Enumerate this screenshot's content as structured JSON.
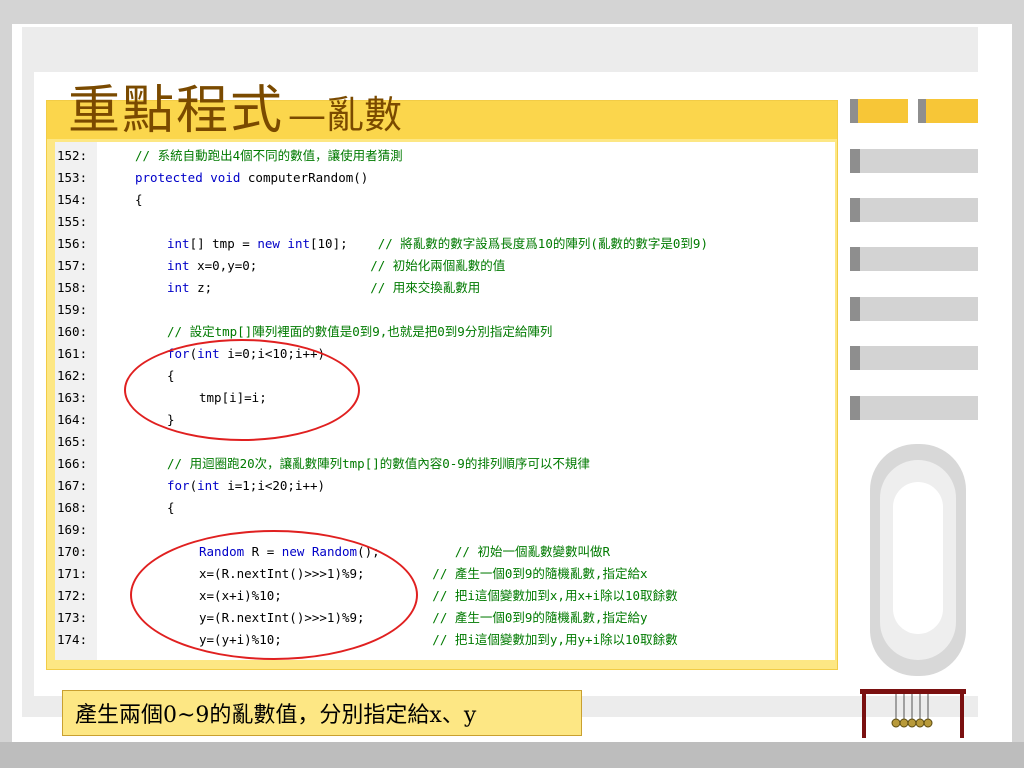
{
  "slide": {
    "title": "重點程式",
    "title_suffix": "—亂數",
    "caption": "產生兩個0~9的亂數值，分別指定給x、y"
  },
  "code": {
    "lines": [
      {
        "num": "152:",
        "indent": 1,
        "tokens": [
          [
            "cm",
            "// 系統自動跑出4個不同的數值，讓使用者猜測"
          ]
        ]
      },
      {
        "num": "153:",
        "indent": 1,
        "tokens": [
          [
            "kw",
            "protected"
          ],
          [
            "tx",
            " "
          ],
          [
            "kw",
            "void"
          ],
          [
            "tx",
            " computerRandom()"
          ]
        ]
      },
      {
        "num": "154:",
        "indent": 1,
        "tokens": [
          [
            "tx",
            "{"
          ]
        ]
      },
      {
        "num": "155:",
        "indent": 0,
        "tokens": []
      },
      {
        "num": "156:",
        "indent": 2,
        "tokens": [
          [
            "kw",
            "int"
          ],
          [
            "tx",
            "[] tmp = "
          ],
          [
            "kw",
            "new"
          ],
          [
            "tx",
            " "
          ],
          [
            "kw",
            "int"
          ],
          [
            "tx",
            "[10];    "
          ],
          [
            "cm",
            "// 將亂數的數字設爲長度爲10的陣列(亂數的數字是0到9)"
          ]
        ]
      },
      {
        "num": "157:",
        "indent": 2,
        "tokens": [
          [
            "kw",
            "int"
          ],
          [
            "tx",
            " x=0,y=0;               "
          ],
          [
            "cm",
            "// 初始化兩個亂數的值"
          ]
        ]
      },
      {
        "num": "158:",
        "indent": 2,
        "tokens": [
          [
            "kw",
            "int"
          ],
          [
            "tx",
            " z;                     "
          ],
          [
            "cm",
            "// 用來交換亂數用"
          ]
        ]
      },
      {
        "num": "159:",
        "indent": 0,
        "tokens": []
      },
      {
        "num": "160:",
        "indent": 2,
        "tokens": [
          [
            "cm",
            "// 設定tmp[]陣列裡面的數值是0到9,也就是把0到9分別指定給陣列"
          ]
        ]
      },
      {
        "num": "161:",
        "indent": 2,
        "tokens": [
          [
            "kw",
            "for"
          ],
          [
            "tx",
            "("
          ],
          [
            "kw",
            "int"
          ],
          [
            "tx",
            " i=0;i<10;i++)"
          ]
        ]
      },
      {
        "num": "162:",
        "indent": 2,
        "tokens": [
          [
            "tx",
            "{"
          ]
        ]
      },
      {
        "num": "163:",
        "indent": 3,
        "tokens": [
          [
            "tx",
            "tmp[i]=i;"
          ]
        ]
      },
      {
        "num": "164:",
        "indent": 2,
        "tokens": [
          [
            "tx",
            "}"
          ]
        ]
      },
      {
        "num": "165:",
        "indent": 0,
        "tokens": []
      },
      {
        "num": "166:",
        "indent": 2,
        "tokens": [
          [
            "cm",
            "// 用迴圈跑20次，讓亂數陣列tmp[]的數值內容0-9的排列順序可以不規律"
          ]
        ]
      },
      {
        "num": "167:",
        "indent": 2,
        "tokens": [
          [
            "kw",
            "for"
          ],
          [
            "tx",
            "("
          ],
          [
            "kw",
            "int"
          ],
          [
            "tx",
            " i=1;i<20;i++)"
          ]
        ]
      },
      {
        "num": "168:",
        "indent": 2,
        "tokens": [
          [
            "tx",
            "{"
          ]
        ]
      },
      {
        "num": "169:",
        "indent": 0,
        "tokens": []
      },
      {
        "num": "170:",
        "indent": 3,
        "tokens": [
          [
            "kw",
            "Random"
          ],
          [
            "tx",
            " R = "
          ],
          [
            "kw",
            "new"
          ],
          [
            "tx",
            " "
          ],
          [
            "kw",
            "Random"
          ],
          [
            "tx",
            "();          "
          ],
          [
            "cm",
            "// 初始一個亂數變數叫做R"
          ]
        ]
      },
      {
        "num": "171:",
        "indent": 3,
        "tokens": [
          [
            "tx",
            "x=(R.nextInt()>>>1)%9;         "
          ],
          [
            "cm",
            "// 產生一個0到9的隨機亂數,指定給x"
          ]
        ]
      },
      {
        "num": "172:",
        "indent": 3,
        "tokens": [
          [
            "tx",
            "x=(x+i)%10;                    "
          ],
          [
            "cm",
            "// 把i這個變數加到x,用x+i除以10取餘數"
          ]
        ]
      },
      {
        "num": "173:",
        "indent": 3,
        "tokens": [
          [
            "tx",
            "y=(R.nextInt()>>>1)%9;         "
          ],
          [
            "cm",
            "// 產生一個0到9的隨機亂數,指定給y"
          ]
        ]
      },
      {
        "num": "174:",
        "indent": 3,
        "tokens": [
          [
            "tx",
            "y=(y+i)%10;                    "
          ],
          [
            "cm",
            "// 把i這個變數加到y,用y+i除以10取餘數"
          ]
        ]
      }
    ]
  }
}
